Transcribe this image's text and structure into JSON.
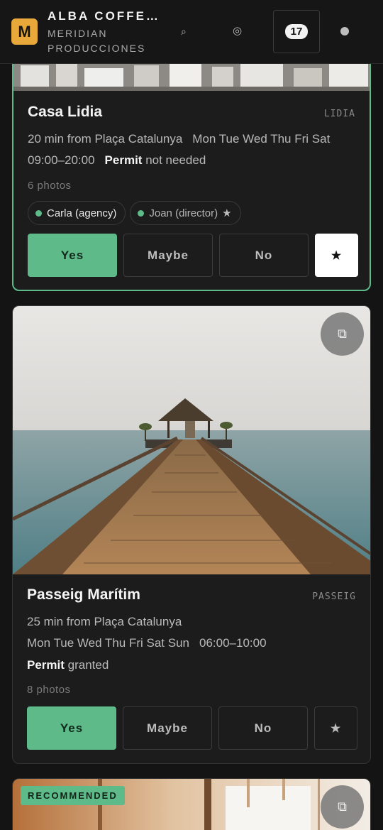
{
  "header": {
    "logo_letter": "M",
    "title": "ALBA COFFEE…",
    "subtitle": "MERIDIAN PRODUCCIONES",
    "search_glyph": "⌕",
    "target_glyph": "◎",
    "count": "17"
  },
  "cards": [
    {
      "name": "Casa Lidia",
      "code": "LIDIA",
      "distance": "20 min from Plaça Catalunya",
      "days": "Mon Tue Wed Thu Fri Sat",
      "hours": "09:00–20:00",
      "permit_label": "Permit",
      "permit_status": "not needed",
      "photos": "6 photos",
      "chips": [
        {
          "label": "Carla (agency)"
        },
        {
          "label": "Joan (director)",
          "star": "★"
        }
      ],
      "actions": {
        "yes": "Yes",
        "maybe": "Maybe",
        "no": "No",
        "fav": "★"
      }
    },
    {
      "name": "Passeig Marítim",
      "code": "PASSEIG",
      "distance": "25 min from Plaça Catalunya",
      "days": "Mon Tue Wed Thu Fri Sat Sun",
      "hours": "06:00–10:00",
      "permit_label": "Permit",
      "permit_status": "granted",
      "photos": "8 photos",
      "actions": {
        "yes": "Yes",
        "maybe": "Maybe",
        "no": "No",
        "fav": "★"
      },
      "copy_glyph": "⧉"
    },
    {
      "badge": "RECOMMENDED",
      "copy_glyph": "⧉"
    }
  ],
  "colors": {
    "accent": "#5fba8a",
    "logo": "#e8a93a",
    "background": "#141414",
    "card": "#1c1c1c"
  },
  "icons": [
    "search-icon",
    "target-icon",
    "star-icon",
    "copy-icon"
  ]
}
